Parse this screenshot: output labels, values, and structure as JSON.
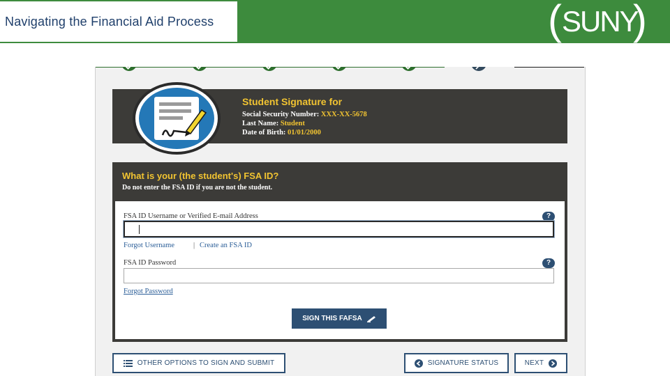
{
  "header": {
    "title": "Navigating the Financial Aid Process",
    "logo_text": "SUNY",
    "accent_color": "#3d8b3d"
  },
  "progress": {
    "steps_completed": 5,
    "current_step": 6
  },
  "signature": {
    "title": "Student Signature for",
    "ssn_label": "Social Security Number:",
    "ssn_value": "XXX-XX-5678",
    "last_name_label": "Last Name:",
    "last_name_value": "Student",
    "dob_label": "Date of Birth:",
    "dob_value": "01/01/2000"
  },
  "form": {
    "question": "What is your (the student's) FSA ID?",
    "warning": "Do not enter the FSA ID if you are not the student.",
    "username_label": "FSA ID Username or Verified E-mail Address",
    "username_value": "",
    "help_label": "?",
    "forgot_username": "Forgot Username",
    "link_separator": "|",
    "create_fsa_id": "Create an FSA ID",
    "password_label": "FSA ID Password",
    "password_value": "",
    "forgot_password": "Forgot Password",
    "sign_button": "SIGN THIS FAFSA"
  },
  "footer": {
    "other_options": "OTHER OPTIONS TO SIGN AND SUBMIT",
    "signature_status": "SIGNATURE STATUS",
    "next": "NEXT"
  },
  "colors": {
    "dark_panel": "#3c3b38",
    "highlight_yellow": "#f2c431",
    "button_blue": "#2d4f73",
    "link_blue": "#2a5d97"
  }
}
